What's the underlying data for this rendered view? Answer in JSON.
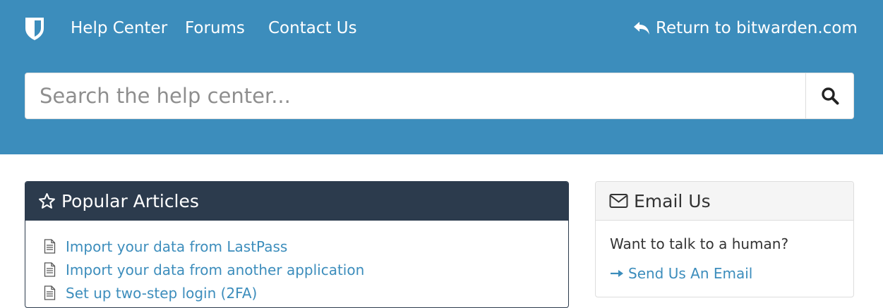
{
  "nav": {
    "help_center": "Help Center",
    "forums": "Forums",
    "contact_us": "Contact Us",
    "return_link": "Return to bitwarden.com"
  },
  "search": {
    "placeholder": "Search the help center..."
  },
  "popular": {
    "title": "Popular Articles",
    "articles": [
      "Import your data from LastPass",
      "Import your data from another application",
      "Set up two-step login (2FA)"
    ]
  },
  "email": {
    "title": "Email Us",
    "text": "Want to talk to a human?",
    "link": "Send Us An Email"
  },
  "colors": {
    "brand_blue": "#3c8dbc",
    "dark_header": "#2c3b4d",
    "white": "#ffffff"
  },
  "icons": [
    "bitwarden-shield-logo",
    "reply-arrow-icon",
    "search-icon",
    "star-outline-icon",
    "document-icon",
    "envelope-icon",
    "right-arrow-icon"
  ]
}
